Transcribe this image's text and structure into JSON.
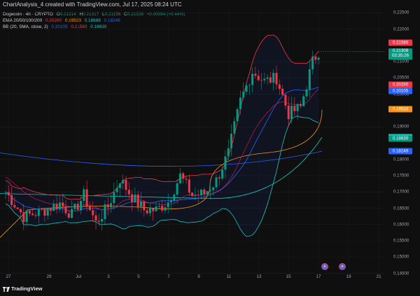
{
  "header": {
    "creator": "ChartAnalysis_4 created with TradingView.com, Jul 17, 2025 08:24 UTC"
  },
  "legend": {
    "symbol": "Dogecoin · 4h · CRYPTO",
    "o_label": "O",
    "o": "0.21214",
    "h_label": "H",
    "h": "0.21317",
    "l_label": "L",
    "l": "0.21156",
    "c_label": "C",
    "c": "0.21308",
    "change": "+0.00094 (+0.44%)",
    "ema_label": "EMA 20/50/100/200",
    "ema20": "0.20290",
    "ema50": "0.19533",
    "ema100": "0.18686",
    "ema200": "0.18249",
    "bb_label": "BB (20, SMA, close, 2)",
    "bb_basis": "0.20105",
    "bb_upper": "0.21580",
    "bb_lower": "0.18630"
  },
  "price_axis": {
    "ticks": [
      "0.22500",
      "0.22000",
      "0.21000",
      "0.20500",
      "0.20000",
      "0.19000",
      "0.18000",
      "0.17500",
      "0.17000",
      "0.16500",
      "0.16000",
      "0.15500",
      "0.15000",
      "0.14500"
    ],
    "tick_values": [
      0.225,
      0.22,
      0.21,
      0.205,
      0.2,
      0.19,
      0.18,
      0.175,
      0.17,
      0.165,
      0.16,
      0.155,
      0.15,
      0.145
    ],
    "tags": [
      {
        "name": "bb-upper-tag",
        "text": "0.21580",
        "value": 0.2158,
        "color": "#f23645"
      },
      {
        "name": "last-price-tag",
        "text": "0.21308",
        "sub": "03:35:26",
        "value": 0.21308,
        "color": "#089981"
      },
      {
        "name": "ema20-tag",
        "text": "0.20290",
        "value": 0.2029,
        "color": "#f23645"
      },
      {
        "name": "bb-basis-tag",
        "text": "0.20105",
        "value": 0.20105,
        "color": "#2962ff"
      },
      {
        "name": "ema50-tag",
        "text": "0.19533",
        "value": 0.19533,
        "color": "#f7931a"
      },
      {
        "name": "ema100-tag",
        "text": "0.18686",
        "value": 0.18686,
        "color": "#19c5c0"
      },
      {
        "name": "bb-lower-tag",
        "text": "0.18630",
        "value": 0.1863,
        "color": "#089981"
      },
      {
        "name": "ema200-tag",
        "text": "0.18249",
        "value": 0.18249,
        "color": "#2962ff"
      }
    ]
  },
  "time_axis": {
    "ticks": [
      "27",
      "29",
      "Jul",
      "3",
      "5",
      "7",
      "9",
      "11",
      "13",
      "15",
      "17",
      "19",
      "21"
    ]
  },
  "footer": {
    "brand": "TradingView"
  },
  "colors": {
    "up": "#089981",
    "down": "#f23645",
    "bb_upper": "#f23645",
    "bb_basis": "#2962ff",
    "bb_lower": "#19c5c0",
    "ema50": "#f7931a",
    "ema200": "#2962ff"
  }
}
